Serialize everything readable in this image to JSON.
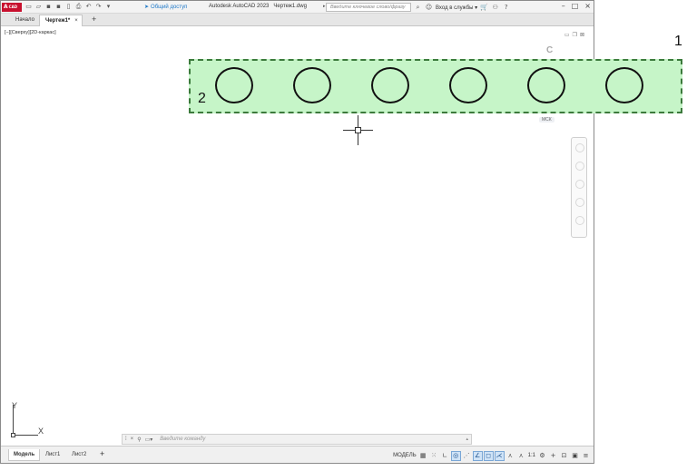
{
  "app": {
    "logo_text": "A",
    "logo_sub": "CAD",
    "title": "Autodesk AutoCAD 2023",
    "file_name": "Чертеж1.dwg",
    "share_label": "Общий доступ",
    "search_placeholder": "Введите ключевое слово/фразу",
    "signin_label": "Вход в службы",
    "help_label": "?"
  },
  "tabs": [
    {
      "label": "Начало"
    },
    {
      "label": "Чертеж1*",
      "close": "×"
    },
    {
      "label": "+"
    }
  ],
  "viewport": {
    "label": "[−][Сверху][2D-каркас]",
    "ucs_label": "МСК",
    "viewcube_letter": "С",
    "axis_x": "X",
    "axis_y": "Y"
  },
  "annotations": {
    "n1": "1",
    "n2": "2"
  },
  "drawing": {
    "circle_count": 6,
    "highlight_color": "#c6f5c8",
    "highlight_border": "#3c7a3c"
  },
  "command": {
    "placeholder": "Введите команду"
  },
  "layouts": [
    {
      "label": "Модель"
    },
    {
      "label": "Лист1"
    },
    {
      "label": "Лист2"
    },
    {
      "label": "+"
    }
  ],
  "status": {
    "mode": "МОДЕЛЬ",
    "scale": "1:1"
  }
}
